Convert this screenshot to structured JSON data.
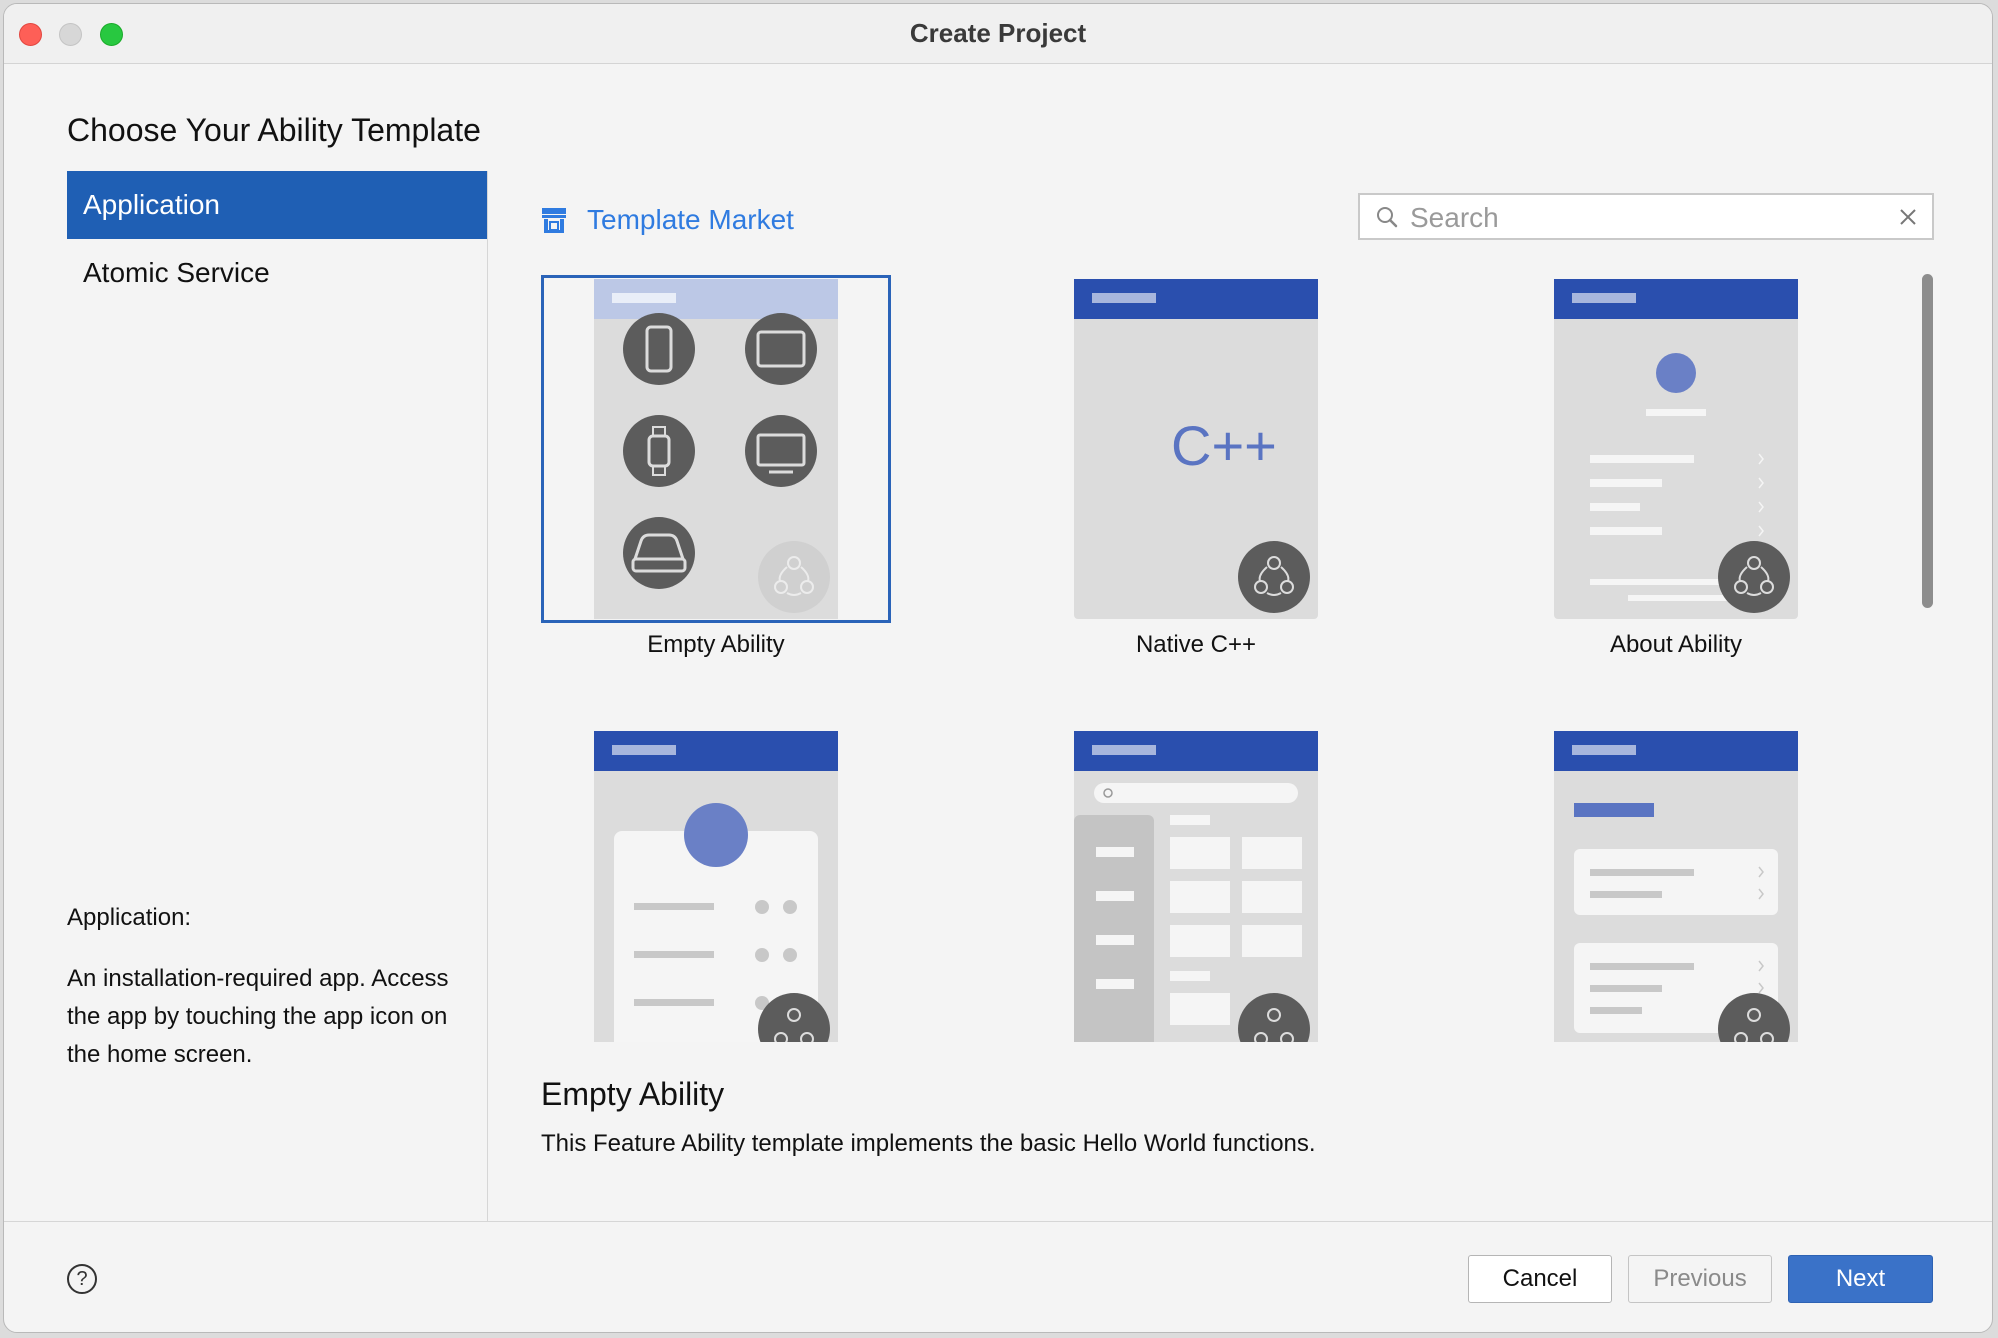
{
  "window": {
    "title": "Create Project"
  },
  "heading": "Choose Your Ability Template",
  "sidebar": {
    "items": [
      {
        "label": "Application",
        "active": true
      },
      {
        "label": "Atomic Service",
        "active": false
      }
    ],
    "description_title": "Application:",
    "description_text": "An installation-required app. Access the app by touching the app icon on the home screen."
  },
  "market": {
    "label": "Template Market",
    "icon": "store-icon"
  },
  "search": {
    "placeholder": "Search",
    "value": ""
  },
  "templates": [
    {
      "name": "Empty Ability",
      "selected": true
    },
    {
      "name": "Native C++",
      "selected": false
    },
    {
      "name": "About Ability",
      "selected": false
    },
    {
      "name": "",
      "selected": false
    },
    {
      "name": "",
      "selected": false
    },
    {
      "name": "",
      "selected": false
    }
  ],
  "thumb_cpp_text": "C++",
  "detail": {
    "title": "Empty Ability",
    "text": "This Feature Ability template implements the basic Hello World functions."
  },
  "footer": {
    "help_label": "?",
    "cancel_label": "Cancel",
    "previous_label": "Previous",
    "next_label": "Next"
  },
  "colors": {
    "accent": "#1f5fb4",
    "link": "#2f7be0",
    "header_blue": "#2a4fae",
    "primary_button": "#3a72c8"
  }
}
